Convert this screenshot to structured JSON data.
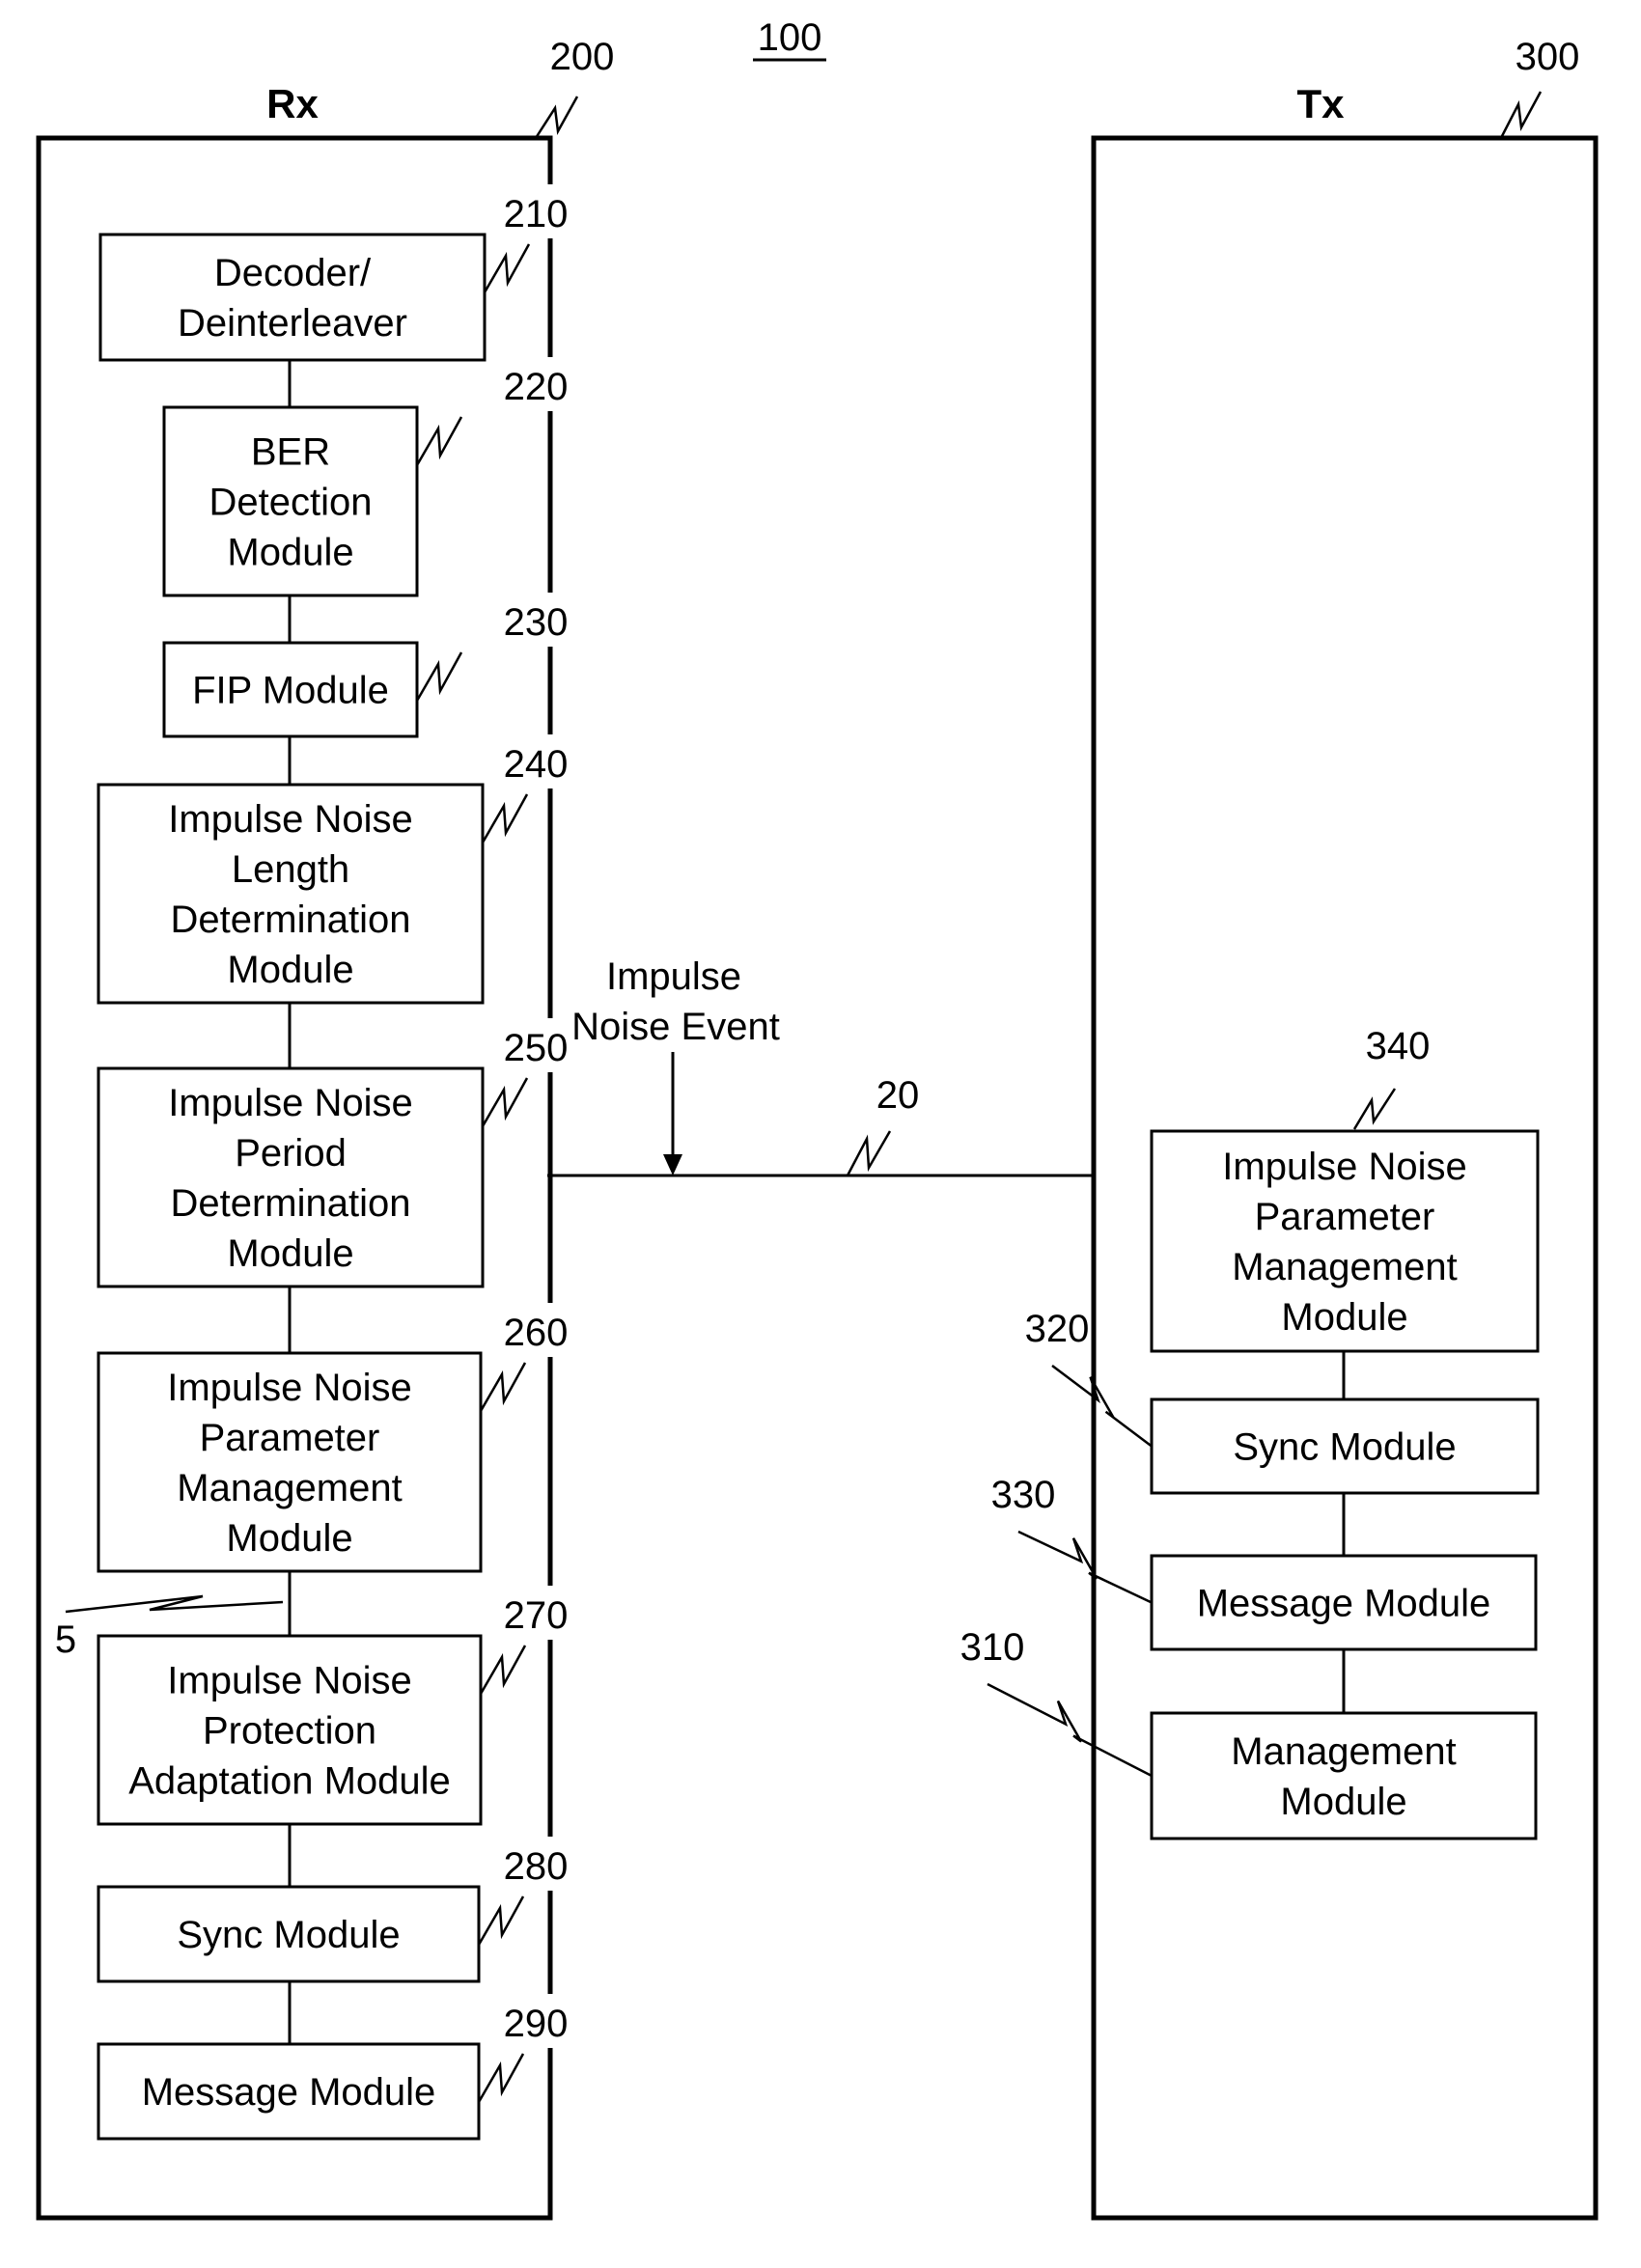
{
  "figure": {
    "ref": "100"
  },
  "rx": {
    "title": "Rx",
    "ref": "200",
    "modules": [
      {
        "ref": "210",
        "lines": [
          "Decoder/",
          "Deinterleaver"
        ]
      },
      {
        "ref": "220",
        "lines": [
          "BER",
          "Detection",
          "Module"
        ]
      },
      {
        "ref": "230",
        "lines": [
          "FIP Module"
        ]
      },
      {
        "ref": "240",
        "lines": [
          "Impulse Noise",
          "Length",
          "Determination",
          "Module"
        ]
      },
      {
        "ref": "250",
        "lines": [
          "Impulse Noise",
          "Period",
          "Determination",
          "Module"
        ]
      },
      {
        "ref": "260",
        "lines": [
          "Impulse Noise",
          "Parameter",
          "Management",
          "Module"
        ]
      },
      {
        "ref": "270",
        "lines": [
          "Impulse Noise",
          "Protection",
          "Adaptation Module"
        ]
      },
      {
        "ref": "280",
        "lines": [
          "Sync Module"
        ]
      },
      {
        "ref": "290",
        "lines": [
          "Message Module"
        ]
      }
    ],
    "link_ref": "5"
  },
  "tx": {
    "title": "Tx",
    "ref": "300",
    "modules": [
      {
        "ref": "340",
        "lines": [
          "Impulse Noise",
          "Parameter",
          "Management",
          "Module"
        ]
      },
      {
        "ref": "320",
        "lines": [
          "Sync Module"
        ]
      },
      {
        "ref": "330",
        "lines": [
          "Message Module"
        ]
      },
      {
        "ref": "310",
        "lines": [
          "Management",
          "Module"
        ]
      }
    ]
  },
  "channel": {
    "ref": "20",
    "event_label": [
      "Impulse",
      "Noise Event"
    ]
  }
}
